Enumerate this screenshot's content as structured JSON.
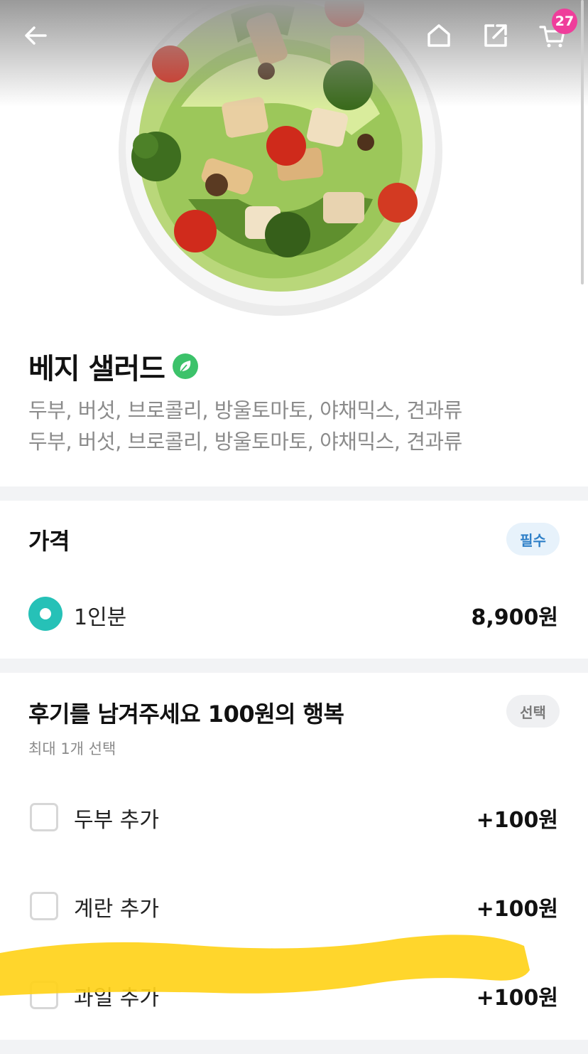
{
  "header": {
    "back_icon": "arrow-left-icon",
    "home_icon": "home-icon",
    "share_icon": "share-icon",
    "cart_icon": "cart-icon",
    "cart_count": "27"
  },
  "product": {
    "image_alt": "salad bowl photo",
    "name": "베지 샐러드",
    "badge_icon": "leaf-icon",
    "description": [
      "두부, 버섯, 브로콜리, 방울토마토, 야채믹스, 견과류",
      "두부, 버섯, 브로콜리, 방울토마토, 야채믹스, 견과류"
    ]
  },
  "price_section": {
    "title": "가격",
    "badge": "필수",
    "option": {
      "label": "1인분",
      "price": "8,900원",
      "selected": true
    }
  },
  "addon_section": {
    "title": "후기를 남겨주세요 100원의 행복",
    "badge": "선택",
    "note": "최대 1개 선택",
    "options": [
      {
        "label": "두부 추가",
        "price": "+100원",
        "checked": false
      },
      {
        "label": "계란 추가",
        "price": "+100원",
        "checked": false
      },
      {
        "label": "과일 추가",
        "price": "+100원",
        "checked": false
      }
    ]
  },
  "colors": {
    "accent_teal": "#26c1b7",
    "required_blue": "#2f80c8",
    "cart_badge_pink": "#ef3e9b",
    "highlight_yellow": "#ffd21a",
    "leaf_green": "#3cc26a"
  }
}
